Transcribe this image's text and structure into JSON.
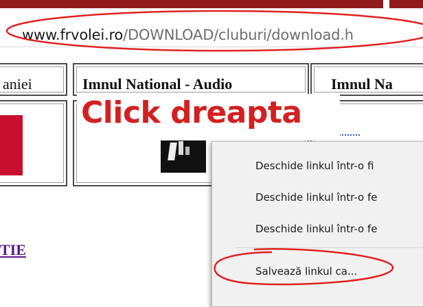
{
  "browser": {
    "url_host": "www.frvolei.ro",
    "url_path": "/DOWNLOAD/cluburi/download.h"
  },
  "table": {
    "headers": [
      "aniei",
      "Imnul National - Audio",
      "Imnul Na"
    ]
  },
  "annotation": {
    "callout_text": "Click dreapta",
    "color": "#d32020"
  },
  "context_menu": {
    "items": [
      "Deschide linkul într-o fi",
      "Deschide linkul într-o fe",
      "Deschide linkul într-o fe",
      "Salvează linkul ca..."
    ]
  },
  "page": {
    "left_link": "TIE"
  }
}
